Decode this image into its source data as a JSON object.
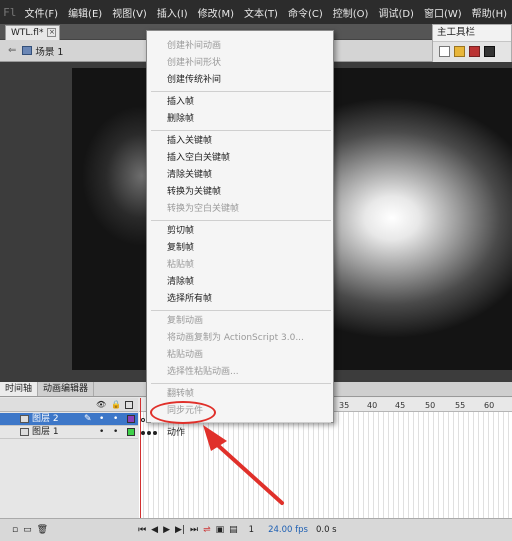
{
  "app": {
    "logo": "Fl"
  },
  "menubar": [
    "文件(F)",
    "编辑(E)",
    "视图(V)",
    "插入(I)",
    "修改(M)",
    "文本(T)",
    "命令(C)",
    "控制(O)",
    "调试(D)",
    "窗口(W)",
    "帮助(H)"
  ],
  "document": {
    "tab": "WTL.fl*",
    "close": "×"
  },
  "editbar": {
    "back": "⇐",
    "scene": "场景 1"
  },
  "toolbar_panel": {
    "title": "主工具栏"
  },
  "timeline": {
    "tabs": [
      "时间轴",
      "动画编辑器"
    ],
    "layers": [
      {
        "name": "图层 2",
        "selected": true,
        "color": "#8b3fb8"
      },
      {
        "name": "图层 1",
        "selected": false,
        "color": "#3fd14a"
      }
    ],
    "ruler": [
      "35",
      "40",
      "45",
      "50",
      "55",
      "60"
    ],
    "footer": {
      "frame": "1",
      "fps": "24.00 fps",
      "time": "0.0 s"
    }
  },
  "context_menu": {
    "items": [
      {
        "label": "创建补间动画",
        "enabled": false
      },
      {
        "label": "创建补间形状",
        "enabled": false
      },
      {
        "label": "创建传统补间",
        "enabled": true
      },
      {
        "sep": true
      },
      {
        "label": "插入帧",
        "enabled": true
      },
      {
        "label": "删除帧",
        "enabled": true
      },
      {
        "sep": true
      },
      {
        "label": "插入关键帧",
        "enabled": true
      },
      {
        "label": "插入空白关键帧",
        "enabled": true
      },
      {
        "label": "清除关键帧",
        "enabled": true
      },
      {
        "label": "转换为关键帧",
        "enabled": true
      },
      {
        "label": "转换为空白关键帧",
        "enabled": false
      },
      {
        "sep": true
      },
      {
        "label": "剪切帧",
        "enabled": true
      },
      {
        "label": "复制帧",
        "enabled": true
      },
      {
        "label": "粘贴帧",
        "enabled": false
      },
      {
        "label": "清除帧",
        "enabled": true
      },
      {
        "label": "选择所有帧",
        "enabled": true
      },
      {
        "sep": true
      },
      {
        "label": "复制动画",
        "enabled": false
      },
      {
        "label": "将动画复制为 ActionScript 3.0...",
        "enabled": false
      },
      {
        "label": "粘贴动画",
        "enabled": false
      },
      {
        "label": "选择性粘贴动画...",
        "enabled": false
      },
      {
        "sep": true
      },
      {
        "label": "翻转帧",
        "enabled": false
      },
      {
        "label": "同步元件",
        "enabled": false
      },
      {
        "sep": true
      },
      {
        "label": "动作",
        "enabled": true
      }
    ]
  },
  "colors": {
    "annotation": "#e0302a"
  }
}
